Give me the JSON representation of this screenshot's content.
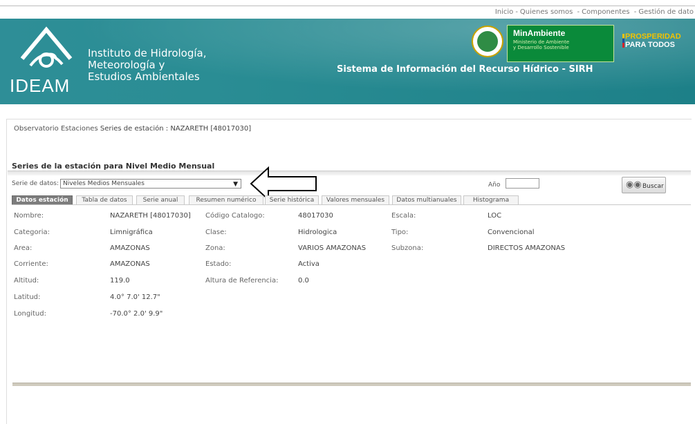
{
  "topnav": {
    "inicio": "Inicio",
    "quienes": "Quienes somos",
    "componentes": "Componentes",
    "gestion": "Gestión de dato"
  },
  "header": {
    "logo_text": "IDEAM",
    "institute_lines": [
      "Instituto de Hidrología,",
      "Meteorología y",
      "Estudios Ambientales"
    ],
    "ministry_title": "MinAmbiente",
    "ministry_sub_lines": [
      "Ministerio de Ambiente",
      "y Desarrollo Sostenible"
    ],
    "prosperidad_l1": "PROSPERIDAD",
    "prosperidad_l2": "PARA TODOS",
    "system_title": "Sistema de Información del Recurso Hídrico - SIRH"
  },
  "breadcrumb": {
    "observatorio": "Observatorio",
    "estaciones": "Estaciones",
    "current": "Series de estación : NAZARETH [48017030]"
  },
  "section": {
    "title": "Series de la estación para Nivel Medio Mensual"
  },
  "filters": {
    "serie_label": "Serie de datos:",
    "serie_value": "Niveles Medios Mensuales",
    "ano_label": "Año",
    "ano_value": "",
    "buscar_label": "Buscar"
  },
  "tabs": [
    {
      "label": "Datos estación",
      "active": true
    },
    {
      "label": "Tabla de datos",
      "active": false
    },
    {
      "label": "Serie anual",
      "active": false
    },
    {
      "label": "Resumen numérico",
      "active": false
    },
    {
      "label": "Serie histórica",
      "active": false
    },
    {
      "label": "Valores mensuales",
      "active": false
    },
    {
      "label": "Datos multianuales",
      "active": false
    },
    {
      "label": "Histograma",
      "active": false
    }
  ],
  "station": {
    "nombre_label": "Nombre:",
    "nombre": "NAZARETH [48017030]",
    "codigo_label": "Código Catalogo:",
    "codigo": "48017030",
    "escala_label": "Escala:",
    "escala": "LOC",
    "categoria_label": "Categoria:",
    "categoria": "Limnigráfica",
    "clase_label": "Clase:",
    "clase": "Hidrologica",
    "tipo_label": "Tipo:",
    "tipo": "Convencional",
    "area_label": "Area:",
    "area": "AMAZONAS",
    "zona_label": "Zona:",
    "zona": "VARIOS AMAZONAS",
    "subzona_label": "Subzona:",
    "subzona": "DIRECTOS AMAZONAS",
    "corriente_label": "Corriente:",
    "corriente": "AMAZONAS",
    "estado_label": "Estado:",
    "estado": "Activa",
    "altitud_label": "Altitud:",
    "altitud": "119.0",
    "altura_label": "Altura de Referencia:",
    "altura": "0.0",
    "latitud_label": "Latitud:",
    "latitud": "4.0° 7.0' 12.7\"",
    "longitud_label": "Longitud:",
    "longitud": "-70.0° 2.0' 9.9\""
  }
}
